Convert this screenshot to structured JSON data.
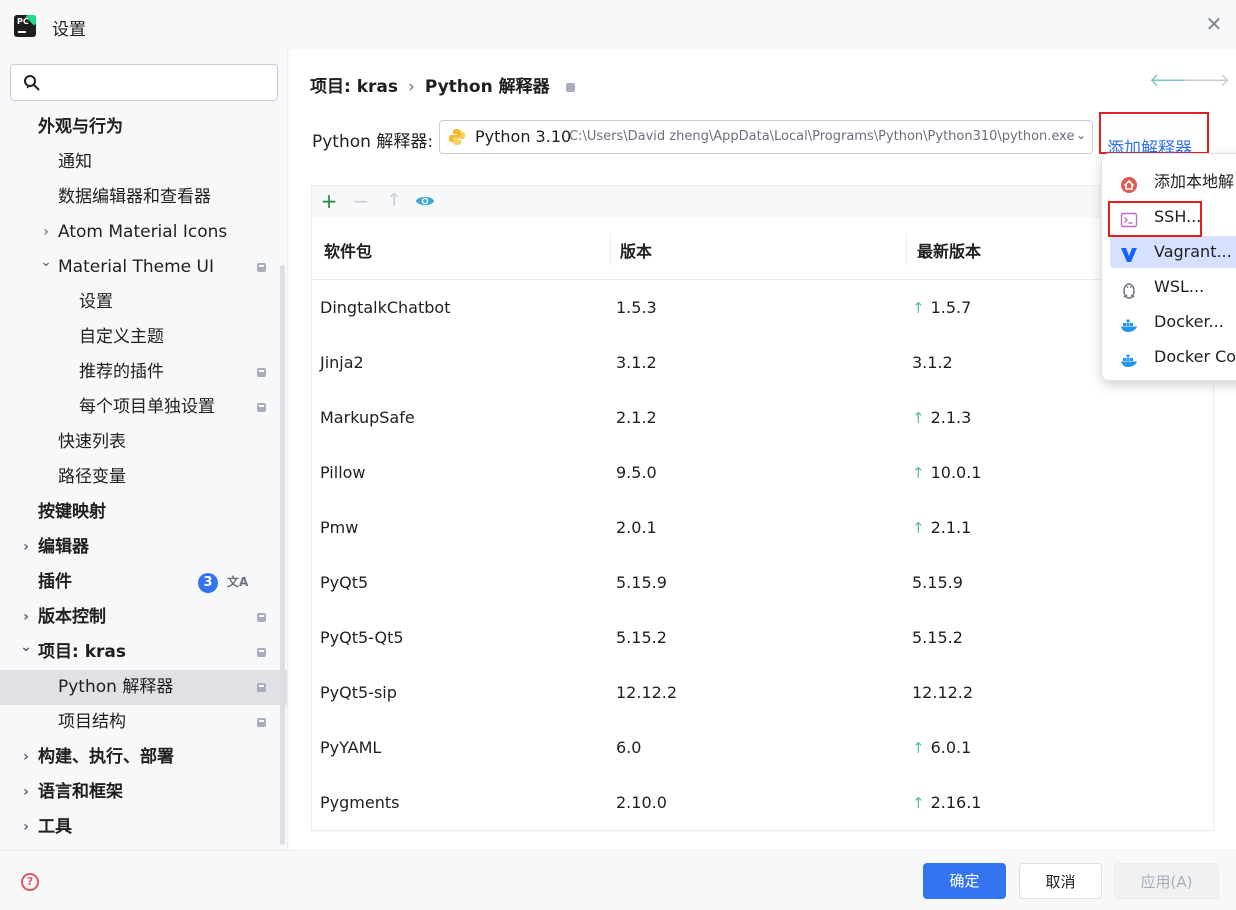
{
  "window": {
    "title": "设置"
  },
  "sidebar": {
    "search": {
      "value": "",
      "placeholder": ""
    },
    "items": [
      {
        "label": "外观与行为",
        "level": 0,
        "expanded": true,
        "bold": true
      },
      {
        "label": "通知",
        "level": 1
      },
      {
        "label": "数据编辑器和查看器",
        "level": 1
      },
      {
        "label": "Atom Material Icons",
        "level": 1,
        "chevron": "right"
      },
      {
        "label": "Material Theme UI",
        "level": 1,
        "chevron": "down",
        "lock": true
      },
      {
        "label": "设置",
        "level": 2
      },
      {
        "label": "自定义主题",
        "level": 2
      },
      {
        "label": "推荐的插件",
        "level": 2,
        "lock": true
      },
      {
        "label": "每个项目单独设置",
        "level": 2,
        "lock": true
      },
      {
        "label": "快速列表",
        "level": 1
      },
      {
        "label": "路径变量",
        "level": 1
      },
      {
        "label": "按键映射",
        "level": 0,
        "bold": true
      },
      {
        "label": "编辑器",
        "level": 0,
        "chevron": "right",
        "bold": true
      },
      {
        "label": "插件",
        "level": 0,
        "bold": true,
        "badge": "3"
      },
      {
        "label": "版本控制",
        "level": 0,
        "chevron": "right",
        "bold": true,
        "lock": true
      },
      {
        "label": "项目: kras",
        "level": 0,
        "chevron": "down",
        "bold": true,
        "lock": true
      },
      {
        "label": "Python 解释器",
        "level": 1,
        "selected": true,
        "lock": true
      },
      {
        "label": "项目结构",
        "level": 1,
        "lock": true
      },
      {
        "label": "构建、执行、部署",
        "level": 0,
        "chevron": "right",
        "bold": true
      },
      {
        "label": "语言和框架",
        "level": 0,
        "chevron": "right",
        "bold": true
      },
      {
        "label": "工具",
        "level": 0,
        "chevron": "right",
        "bold": true
      }
    ]
  },
  "breadcrumb": {
    "project": "项目: kras",
    "separator": "›",
    "page": "Python 解释器"
  },
  "interpreter": {
    "label": "Python 解释器:",
    "name": "Python 3.10",
    "path": "C:\\Users\\David zheng\\AppData\\Local\\Programs\\Python\\Python310\\python.exe",
    "add_label": "添加解释器",
    "add_chevron": "⌄"
  },
  "packages": {
    "columns": [
      "软件包",
      "版本",
      "最新版本"
    ],
    "rows": [
      {
        "name": "DingtalkChatbot",
        "version": "1.5.3",
        "latest": "1.5.7",
        "upgrade": true
      },
      {
        "name": "Jinja2",
        "version": "3.1.2",
        "latest": "3.1.2",
        "upgrade": false
      },
      {
        "name": "MarkupSafe",
        "version": "2.1.2",
        "latest": "2.1.3",
        "upgrade": true
      },
      {
        "name": "Pillow",
        "version": "9.5.0",
        "latest": "10.0.1",
        "upgrade": true
      },
      {
        "name": "Pmw",
        "version": "2.0.1",
        "latest": "2.1.1",
        "upgrade": true
      },
      {
        "name": "PyQt5",
        "version": "5.15.9",
        "latest": "5.15.9",
        "upgrade": false
      },
      {
        "name": "PyQt5-Qt5",
        "version": "5.15.2",
        "latest": "5.15.2",
        "upgrade": false
      },
      {
        "name": "PyQt5-sip",
        "version": "12.12.2",
        "latest": "12.12.2",
        "upgrade": false
      },
      {
        "name": "PyYAML",
        "version": "6.0",
        "latest": "6.0.1",
        "upgrade": true
      },
      {
        "name": "Pygments",
        "version": "2.10.0",
        "latest": "2.16.1",
        "upgrade": true
      }
    ]
  },
  "popup": {
    "items": [
      {
        "label": "添加本地解",
        "icon": "home-icon"
      },
      {
        "label": "SSH...",
        "icon": "terminal-icon"
      },
      {
        "label": "Vagrant...",
        "icon": "vagrant-icon",
        "highlighted": true
      },
      {
        "label": "WSL...",
        "icon": "linux-icon"
      },
      {
        "label": "Docker...",
        "icon": "docker-icon"
      },
      {
        "label": "Docker Cor",
        "icon": "docker-compose-icon"
      }
    ]
  },
  "footer": {
    "ok": "确定",
    "cancel": "取消",
    "apply": "应用(A)"
  },
  "colors": {
    "accent": "#3574f0",
    "highlight_box": "#e02020",
    "selection": "#dfe1e5",
    "upgrade_arrow": "#5fb8b0"
  }
}
